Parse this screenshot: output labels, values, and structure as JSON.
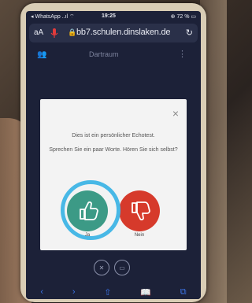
{
  "status": {
    "left": "◂ WhatsApp ..ıl ⌔",
    "time": "19:25",
    "right": "⊕ 72 % ▭"
  },
  "browser": {
    "aa": "aA",
    "url": "bb7.schulen.dinslaken.de",
    "reload": "↻"
  },
  "page": {
    "title": "Dartraum"
  },
  "dialog": {
    "message1": "Dies ist ein persönlicher Echotest.",
    "message2": "Sprechen Sie ein paar Worte. Hören Sie sich selbst?",
    "yes_label": "Ja",
    "no_label": "Nein",
    "close": "×"
  },
  "colors": {
    "yes": "#3c9a86",
    "no": "#d63a2b",
    "highlight": "#48b8e6"
  },
  "icons": [
    "thumbs-up-icon",
    "thumbs-down-icon",
    "microphone-icon",
    "lock-icon"
  ]
}
